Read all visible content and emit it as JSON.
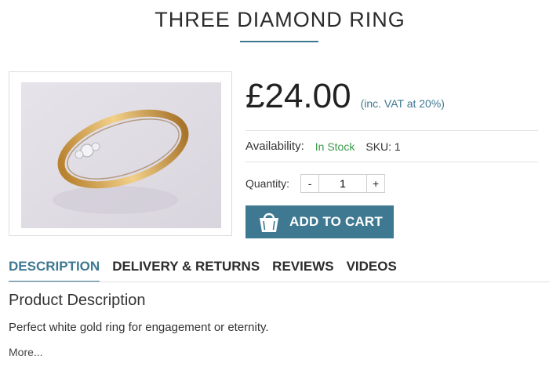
{
  "product": {
    "title": "THREE DIAMOND RING",
    "price": "£24.00",
    "vat_note": "(inc. VAT at 20%)",
    "availability_label": "Availability:",
    "availability_value": "In Stock",
    "sku": "SKU: 1",
    "quantity_label": "Quantity:",
    "quantity_value": "1",
    "minus_label": "-",
    "plus_label": "+",
    "add_to_cart_label": "ADD TO CART"
  },
  "tabs": [
    {
      "label": "DESCRIPTION",
      "active": true
    },
    {
      "label": "DELIVERY & RETURNS",
      "active": false
    },
    {
      "label": "REVIEWS",
      "active": false
    },
    {
      "label": "VIDEOS",
      "active": false
    }
  ],
  "description": {
    "heading": "Product Description",
    "text": "Perfect white gold ring for engagement or eternity.",
    "more_label": "More..."
  },
  "colors": {
    "accent": "#3f7891",
    "in_stock": "#3a9a4a"
  },
  "icons": {
    "cart": "shopping-bag-icon"
  }
}
